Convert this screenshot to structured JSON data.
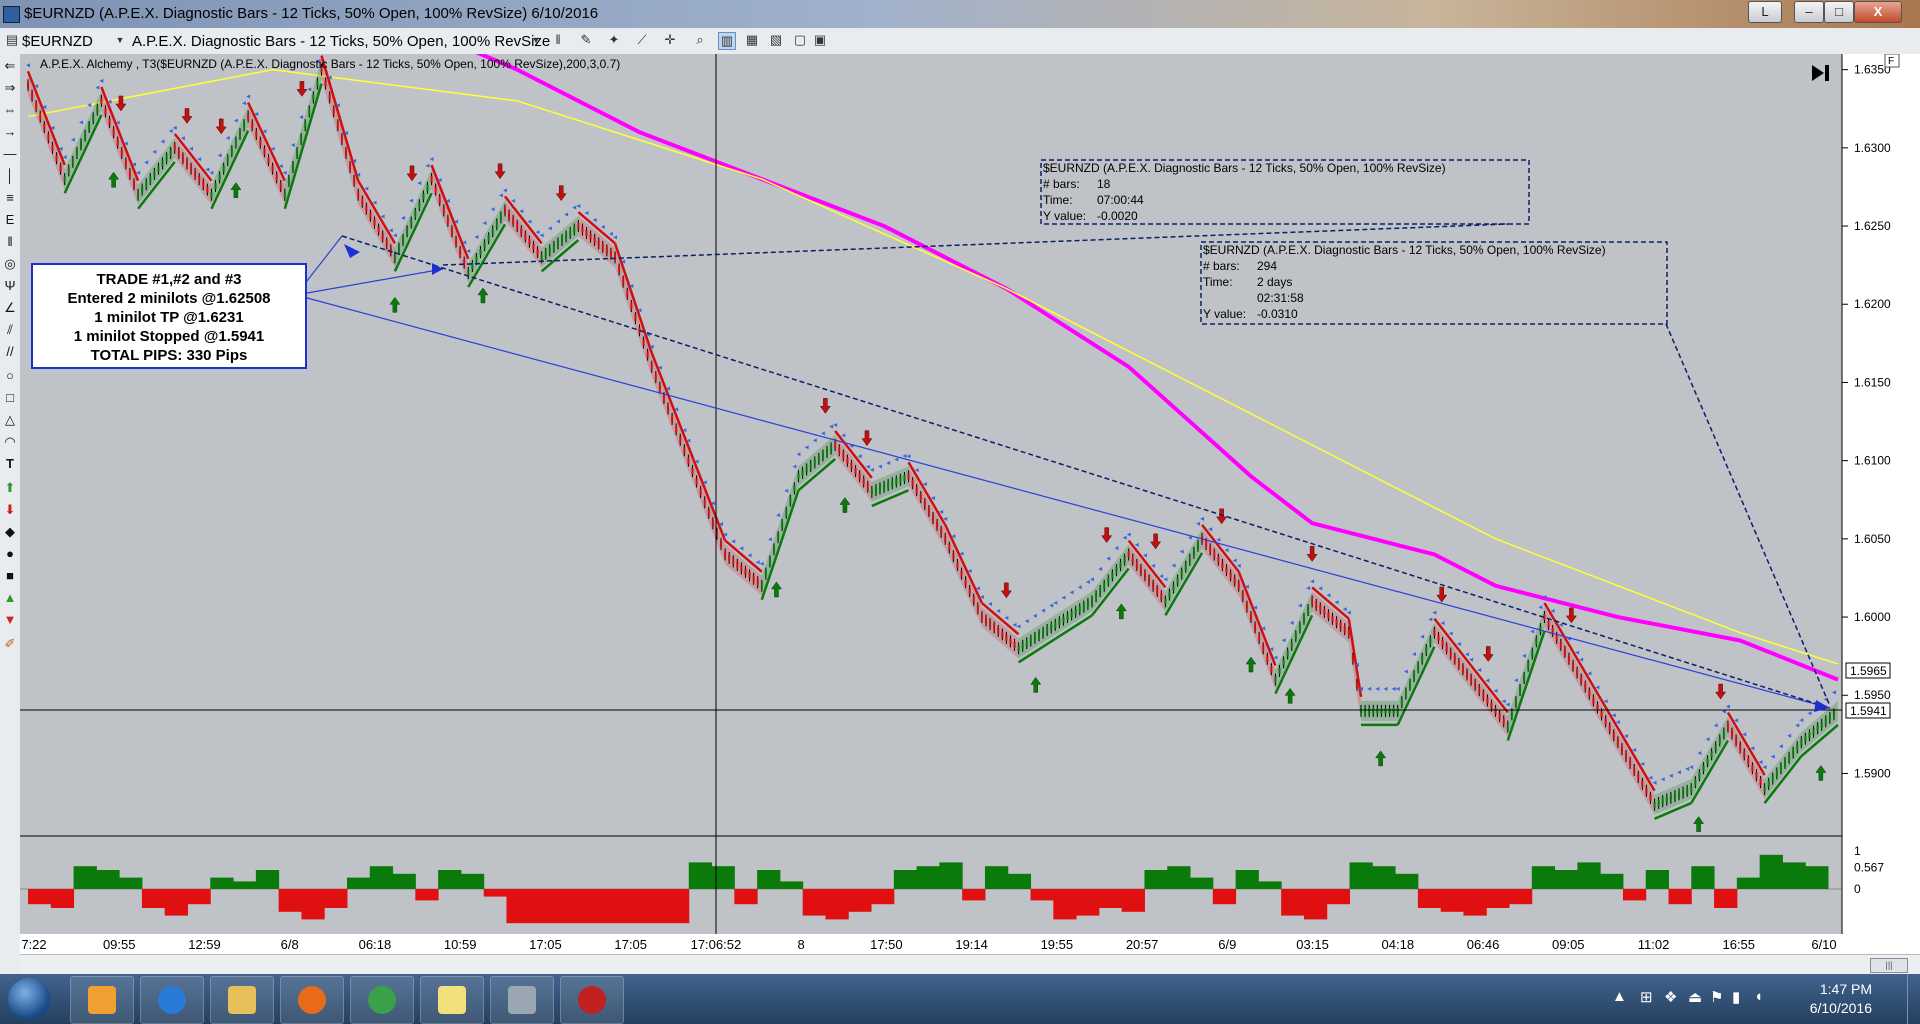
{
  "window": {
    "title": "$EURNZD (A.P.E.X. Diagnostic Bars - 12 Ticks, 50% Open, 100% RevSize)  6/10/2016",
    "buttons": {
      "lang": "L",
      "minimize": "–",
      "maximize": "□",
      "close": "X"
    }
  },
  "toolbar": {
    "symbol": "$EURNZD",
    "bar_type": "A.P.E.X. Diagnostic Bars - 12 Ticks, 50% Open, 100% RevSize"
  },
  "chart_data": {
    "type": "line",
    "title": "A.P.E.X. Alchemy , T3($EURNZD (A.P.E.X. Diagnostic Bars - 12 Ticks, 50% Open, 100% RevSize),200,3,0.7)",
    "x_labels": [
      "7:22",
      "09:55",
      "12:59",
      "6/8",
      "06:18",
      "10:59",
      "17:05",
      "17:05",
      "17:06:52",
      "8",
      "17:50",
      "19:14",
      "19:55",
      "20:57",
      "6/9",
      "03:15",
      "04:18",
      "06:46",
      "09:05",
      "11:02",
      "16:55",
      "6/10"
    ],
    "y_ticks": [
      "1.6350",
      "1.6300",
      "1.6250",
      "1.6200",
      "1.6150",
      "1.6100",
      "1.6050",
      "1.6000",
      "1.5950",
      "1.5900"
    ],
    "ylim": [
      1.586,
      1.636
    ],
    "price_x": [
      0,
      30,
      60,
      90,
      120,
      150,
      180,
      210,
      240,
      270,
      300,
      330,
      360,
      390,
      420,
      450,
      480,
      510,
      540,
      570,
      600,
      630,
      660,
      690,
      720,
      750,
      780,
      810,
      840,
      870,
      900,
      930,
      960,
      990,
      1020,
      1050,
      1080,
      1090,
      1120,
      1150,
      1180,
      1210,
      1240,
      1270,
      1300,
      1330,
      1360,
      1390,
      1420,
      1450,
      1480
    ],
    "price_y": [
      1.634,
      1.628,
      1.633,
      1.627,
      1.63,
      1.627,
      1.632,
      1.627,
      1.635,
      1.627,
      1.623,
      1.628,
      1.622,
      1.626,
      1.623,
      1.625,
      1.623,
      1.616,
      1.61,
      1.604,
      1.602,
      1.609,
      1.611,
      1.608,
      1.609,
      1.605,
      1.6,
      1.598,
      1.5995,
      1.601,
      1.604,
      1.601,
      1.605,
      1.602,
      1.596,
      1.601,
      1.599,
      1.594,
      1.594,
      1.599,
      1.596,
      1.593,
      1.6,
      1.596,
      1.592,
      1.588,
      1.589,
      1.593,
      1.589,
      1.592,
      1.594
    ],
    "series": [
      {
        "name": "",
        "color": "#ff00ff",
        "x": [
          340,
          400,
          500,
          600,
          700,
          800,
          900,
          1000,
          1050,
          1100,
          1150,
          1200,
          1250,
          1300,
          1400,
          1480
        ],
        "y": [
          1.637,
          1.635,
          1.631,
          1.628,
          1.625,
          1.621,
          1.616,
          1.609,
          1.606,
          1.605,
          1.604,
          1.602,
          1.601,
          1.6,
          1.5985,
          1.596
        ]
      },
      {
        "name": "",
        "color": "#ffff33",
        "x": [
          0,
          200,
          400,
          600,
          800,
          1000,
          1200,
          1400,
          1480
        ],
        "y": [
          1.632,
          1.635,
          1.633,
          1.628,
          1.621,
          1.613,
          1.605,
          1.599,
          1.597
        ]
      }
    ],
    "current_price": "1.5965",
    "stop_price": "1.5941",
    "up_arrows_x": [
      70,
      170,
      300,
      372,
      612,
      668,
      824,
      894,
      1000,
      1032,
      1106,
      1366,
      1466
    ],
    "down_arrows_x": [
      76,
      130,
      158,
      224,
      314,
      386,
      436,
      652,
      686,
      800,
      882,
      922,
      976,
      1050,
      1156,
      1194,
      1262,
      1384
    ],
    "oscillator": {
      "ticks": [
        "1",
        "0.567",
        "0"
      ],
      "values": [
        -0.4,
        -0.5,
        0.6,
        0.5,
        0.3,
        -0.5,
        -0.7,
        -0.4,
        0.3,
        0.2,
        0.5,
        -0.6,
        -0.8,
        -0.5,
        0.3,
        0.6,
        0.4,
        -0.3,
        0.5,
        0.4,
        -0.2,
        -0.9,
        -0.9,
        -0.9,
        -0.9,
        -0.9,
        -0.9,
        -0.9,
        -0.9,
        0.7,
        0.6,
        -0.4,
        0.5,
        0.2,
        -0.7,
        -0.8,
        -0.6,
        -0.4,
        0.5,
        0.6,
        0.7,
        -0.3,
        0.6,
        0.4,
        -0.3,
        -0.8,
        -0.7,
        -0.5,
        -0.6,
        0.5,
        0.6,
        0.3,
        -0.4,
        0.5,
        0.2,
        -0.7,
        -0.8,
        -0.4,
        0.7,
        0.6,
        0.4,
        -0.5,
        -0.6,
        -0.7,
        -0.5,
        -0.4,
        0.6,
        0.5,
        0.7,
        0.4,
        -0.3,
        0.5,
        -0.4,
        0.6,
        -0.5,
        0.3,
        0.9,
        0.7,
        0.6
      ]
    }
  },
  "annotations": {
    "trade_box": {
      "line1": "TRADE #1,#2 and #3",
      "line2": "Entered 2 minilots @1.62508",
      "line3": "1 minilot TP @1.6231",
      "line4": "1 minilot Stopped @1.5941",
      "line5": "TOTAL PIPS: 330 Pips"
    },
    "measure1": {
      "title": "$EURNZD (A.P.E.X. Diagnostic Bars - 12 Ticks, 50% Open, 100% RevSize)",
      "bars_label": "# bars:",
      "bars_value": "18",
      "time_label": "Time:",
      "time_value": "07:00:44",
      "y_label": "Y value:",
      "y_value": "-0.0020"
    },
    "measure2": {
      "title": "$EURNZD (A.P.E.X. Diagnostic Bars - 12 Ticks, 50% Open, 100% RevSize)",
      "bars_label": "# bars:",
      "bars_value": "294",
      "time_label": "Time:",
      "time_value": "2 days",
      "time_value2": "02:31:58",
      "y_label": "Y value:",
      "y_value": "-0.0310"
    }
  },
  "taskbar": {
    "time": "1:47 PM",
    "date": "6/10/2016"
  }
}
